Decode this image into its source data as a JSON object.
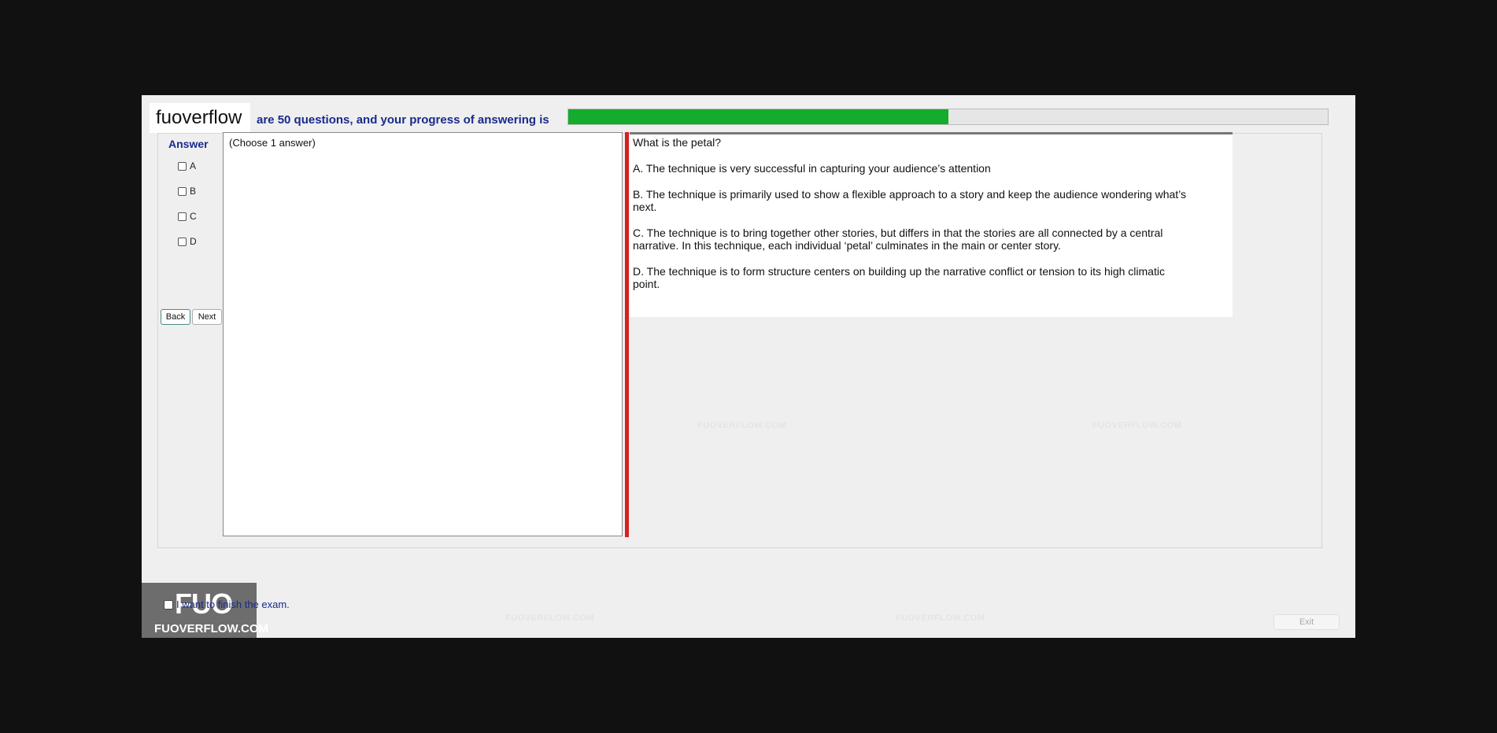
{
  "brand": {
    "logo_text": "fuoverflow"
  },
  "header": {
    "progress_text": "are 50 questions, and your progress of answering is",
    "progress_fraction": 0.5,
    "progress_color": "#14ac2c"
  },
  "answer_panel": {
    "label": "Answer",
    "options": [
      "A",
      "B",
      "C",
      "D"
    ],
    "back_label": "Back",
    "next_label": "Next",
    "choose_hint": "(Choose 1 answer)"
  },
  "question": {
    "text": "What is the petal?",
    "choices": [
      "A.  The technique is very successful in capturing your audience’s attention",
      "B.  The technique is primarily used to show a flexible approach to a story and keep the audience wondering what’s next.",
      "C.  The technique is to bring together other stories, but differs in that the stories are all connected by a central narrative. In this technique, each individual ‘petal’ culminates in the main or center story.",
      "D.  The technique is to form structure centers on building up the narrative conflict or tension to its high climatic point."
    ]
  },
  "watermark": {
    "text": "FUOVERFLOW.COM",
    "logo": "FUO"
  },
  "footer": {
    "finish_text": "I want to finish the exam.",
    "exit_label": "Exit",
    "logo_big": "FUO",
    "logo_small": "FUOVERFLOW.COM"
  },
  "colors": {
    "divider": "#d81f1f",
    "label_blue": "#1a2a8c"
  }
}
